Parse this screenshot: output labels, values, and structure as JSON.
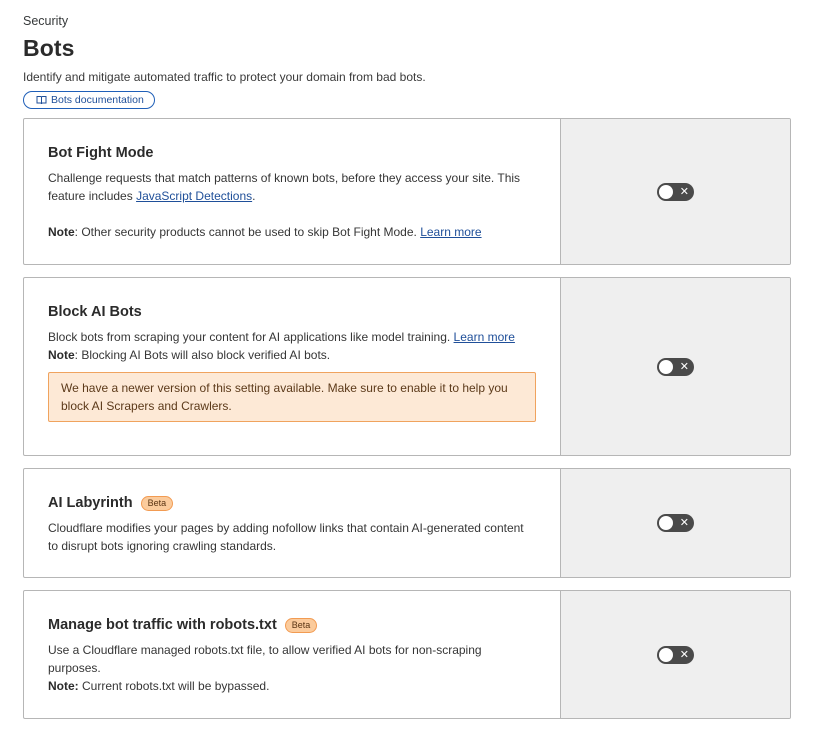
{
  "breadcrumb": "Security",
  "page_title": "Bots",
  "subtitle": "Identify and mitigate automated traffic to protect your domain from bad bots.",
  "doc_link": {
    "label": "Bots documentation",
    "icon": "book-icon"
  },
  "cards": [
    {
      "title": "Bot Fight Mode",
      "desc_prefix": "Challenge requests that match patterns of known bots, before they access your site. This feature includes ",
      "desc_link": "JavaScript Detections",
      "desc_suffix": ".",
      "note_label": "Note",
      "note_text": ": Other security products cannot be used to skip Bot Fight Mode. ",
      "note_link": "Learn more",
      "toggle": {
        "enabled": false,
        "off_glyph": "✕"
      }
    },
    {
      "title": "Block AI Bots",
      "desc_prefix": "Block bots from scraping your content for AI applications like model training. ",
      "desc_link": "Learn more",
      "note_label": "Note",
      "note_text": ": Blocking AI Bots will also block verified AI bots.",
      "warning": "We have a newer version of this setting available. Make sure to enable it to help you block AI Scrapers and Crawlers.",
      "toggle": {
        "enabled": false,
        "off_glyph": "✕"
      }
    },
    {
      "title": "AI Labyrinth",
      "badge": "Beta",
      "desc": "Cloudflare modifies your pages by adding nofollow links that contain AI-generated content to disrupt bots ignoring crawling standards.",
      "toggle": {
        "enabled": false,
        "off_glyph": "✕"
      }
    },
    {
      "title": "Manage bot traffic with robots.txt",
      "badge": "Beta",
      "desc": "Use a Cloudflare managed robots.txt file, to allow verified AI bots for non-scraping purposes.",
      "note_label": "Note:",
      "note_text": " Current robots.txt will be bypassed.",
      "toggle": {
        "enabled": false,
        "off_glyph": "✕"
      }
    }
  ],
  "colors": {
    "link": "#1f4f99",
    "toggle_off": "#4a4a4a",
    "side_panel": "#efefef",
    "warning_bg": "#fde9d6",
    "warning_border": "#f0a35e",
    "beta_bg": "#fbcb9c"
  }
}
